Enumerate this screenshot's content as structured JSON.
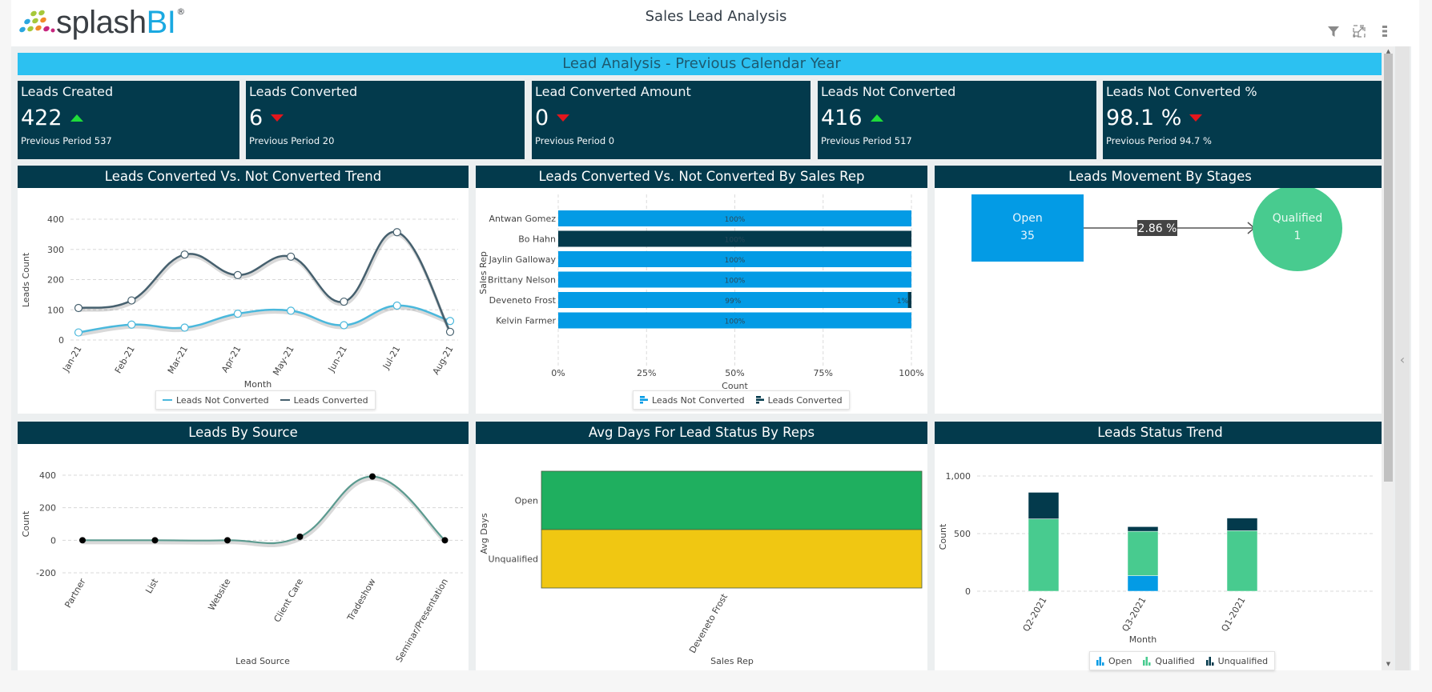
{
  "header": {
    "logo_main": "splash",
    "logo_accent": "BI",
    "logo_reg": "®",
    "title": "Sales Lead Analysis",
    "toolbar": [
      {
        "icon": "filter-icon",
        "label": "Filter"
      },
      {
        "icon": "expand-icon",
        "label": "Expand"
      },
      {
        "icon": "more-vertical-icon",
        "label": "More options"
      }
    ]
  },
  "banner": "Lead Analysis - Previous Calendar Year",
  "kpis": [
    {
      "title": "Leads Created",
      "value": "422",
      "trend": "up",
      "previous": "Previous Period 537"
    },
    {
      "title": "Leads Converted",
      "value": "6",
      "trend": "down",
      "previous": "Previous Period 20"
    },
    {
      "title": "Lead Converted Amount",
      "value": "0",
      "trend": "down",
      "previous": "Previous Period 0"
    },
    {
      "title": "Leads Not Converted",
      "value": "416",
      "trend": "up",
      "previous": "Previous Period 517"
    },
    {
      "title": "Leads Not Converted %",
      "value": "98.1 %",
      "trend": "down",
      "previous": "Previous Period 94.7 %"
    }
  ],
  "colors": {
    "header_dark": "#033a4c",
    "banner": "#2cc1f1",
    "up": "#1fdc3a",
    "down": "#e4161c",
    "not_converted": "#4ab8dc",
    "converted": "#46606e",
    "bar_light": "#039be5",
    "bar_dark": "#033a4c",
    "open": "#039be5",
    "qualified": "#48cb8f",
    "unqualified": "#033a4c",
    "source_line": "#5b9a8f",
    "heat_open": "#1faf5f",
    "heat_unqualified": "#f0c712"
  },
  "panels": {
    "trend": {
      "title": "Leads Converted Vs. Not Converted Trend"
    },
    "by_rep": {
      "title": "Leads Converted Vs. Not Converted By Sales Rep"
    },
    "movement": {
      "title": "Leads Movement By Stages",
      "from": {
        "label": "Open",
        "value": "35"
      },
      "to": {
        "label": "Qualified",
        "value": "1"
      },
      "rate": "2.86 %"
    },
    "source": {
      "title": "Leads By Source"
    },
    "avg_days": {
      "title": "Avg Days For Lead Status By Reps"
    },
    "status_trend": {
      "title": "Leads Status Trend"
    }
  },
  "chart_data": [
    {
      "id": "trend",
      "type": "line",
      "title": "Leads Converted Vs. Not Converted Trend",
      "xlabel": "Month",
      "ylabel": "Leads Count",
      "categories": [
        "Jan-21",
        "Feb-21",
        "Mar-21",
        "Apr-21",
        "May-21",
        "Jun-21",
        "Jul-21",
        "Aug-21"
      ],
      "series": [
        {
          "name": "Leads Not Converted",
          "values": [
            25,
            51,
            41,
            87,
            97,
            49,
            114,
            63
          ]
        },
        {
          "name": "Leads Converted",
          "values": [
            106,
            131,
            283,
            215,
            276,
            127,
            357,
            27
          ]
        }
      ],
      "ylim": [
        0,
        400
      ],
      "yticks": [
        0,
        100,
        200,
        300,
        400
      ],
      "grid": true,
      "legend": "bottom"
    },
    {
      "id": "by_rep",
      "type": "bar",
      "orientation": "horizontal",
      "stacked": "percent",
      "title": "Leads Converted Vs. Not Converted By Sales Rep",
      "xlabel": "Count",
      "ylabel": "Sales Rep",
      "categories": [
        "Antwan Gomez",
        "Bo Hahn",
        "Jaylin Galloway",
        "Brittany Nelson",
        "Deveneto Frost",
        "Kelvin Farmer"
      ],
      "series": [
        {
          "name": "Leads Not Converted",
          "values": [
            100,
            0,
            100,
            100,
            99,
            100
          ]
        },
        {
          "name": "Leads Converted",
          "values": [
            0,
            100,
            0,
            0,
            1,
            0
          ]
        }
      ],
      "xticks": [
        "0%",
        "25%",
        "50%",
        "75%",
        "100%"
      ],
      "grid": true,
      "legend": "bottom"
    },
    {
      "id": "source",
      "type": "line",
      "title": "Leads By Source",
      "xlabel": "Lead Source",
      "ylabel": "Count",
      "categories": [
        "Partner",
        "List",
        "Website",
        "Client Care",
        "Tradeshow",
        "Seminar/Presentation"
      ],
      "values": [
        0,
        0,
        0,
        22,
        392,
        0
      ],
      "ylim": [
        -200,
        400
      ],
      "yticks": [
        -200,
        0,
        200,
        400
      ],
      "grid": true
    },
    {
      "id": "avg_days",
      "type": "heatmap",
      "title": "Avg Days For Lead Status By Reps",
      "xlabel": "Sales Rep",
      "ylabel": "Avg Days",
      "x": [
        "Deveneto Frost"
      ],
      "y": [
        "Open",
        "Unqualified"
      ]
    },
    {
      "id": "status_trend",
      "type": "bar",
      "stacked": true,
      "title": "Leads Status Trend",
      "xlabel": "Month",
      "ylabel": "Count",
      "categories": [
        "Q2-2021",
        "Q3-2021",
        "Q1-2021"
      ],
      "series": [
        {
          "name": "Open",
          "values": [
            0,
            135,
            0
          ]
        },
        {
          "name": "Qualified",
          "values": [
            628,
            385,
            525
          ]
        },
        {
          "name": "Unqualified",
          "values": [
            230,
            40,
            110
          ]
        }
      ],
      "ylim": [
        0,
        1000
      ],
      "yticks": [
        "0",
        "500",
        "1,000"
      ],
      "grid": true,
      "legend": "bottom"
    }
  ]
}
